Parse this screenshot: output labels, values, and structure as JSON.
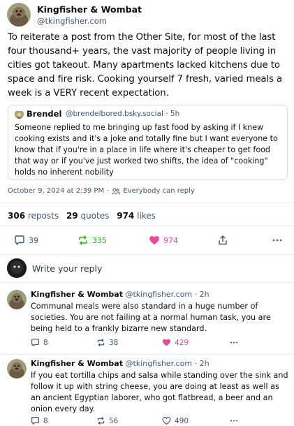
{
  "post": {
    "author": {
      "name": "Kingfisher & Wombat",
      "handle": "@tkingfisher.com"
    },
    "text": "To reiterate a post from the Other Site, for most of the last four thousand+ years, the vast majority of people living in cities got takeout. Many apartments lacked kitchens due to space and fire risk. Cooking yourself 7 fresh, varied meals a week is a VERY recent expectation.",
    "quote": {
      "author_name": "Brendel",
      "meta": "@brendelbored.bsky.social · 5h",
      "text": "Someone replied to me bringing up fast food by asking if I knew cooking exists and it's a joke and totally fine but I want everyone to know that if you're in a place in life where it's cheaper to get food that way or if you've just worked two shifts, the idea of \"cooking\" holds no inherent nobility"
    },
    "timestamp": "October 9, 2024 at 2:39 PM",
    "reply_permission": "Everybody can reply",
    "stats": {
      "reposts_count": "306",
      "reposts_label": "reposts",
      "quotes_count": "29",
      "quotes_label": "quotes",
      "likes_count": "974",
      "likes_label": "likes"
    },
    "actions": {
      "replies": "39",
      "reposts": "335",
      "likes": "974"
    }
  },
  "reply_box": {
    "placeholder": "Write your reply"
  },
  "replies": [
    {
      "name": "Kingfisher & Wombat",
      "meta": "@tkingfisher.com · 2h",
      "text": "Communal meals were also standard in a huge number of societies. You are not failing at a normal human task, you are being held to a frankly bizarre new standard.",
      "replies": "8",
      "reposts": "38",
      "likes": "429"
    },
    {
      "name": "Kingfisher & Wombat",
      "meta": "@tkingfisher.com · 2h",
      "text": "If you eat tortilla chips and salsa while standing over the sink and follow it up with string cheese, you are doing at least as well as an ancient Egyptian laborer, who got flatbread, a beer and an onion every day.",
      "replies": "8",
      "reposts": "56",
      "likes": "490"
    }
  ],
  "colors": {
    "text": "#0b0f14",
    "muted": "#42576c",
    "repost_green": "#20bc07",
    "like_pink": "#ec4899",
    "border": "#d4dbe2"
  },
  "icons": {
    "reply": "speech-bubble-icon",
    "repost": "repost-arrows-icon",
    "like": "heart-icon",
    "share": "share-icon",
    "more": "ellipsis-icon",
    "permission": "people-icon"
  }
}
